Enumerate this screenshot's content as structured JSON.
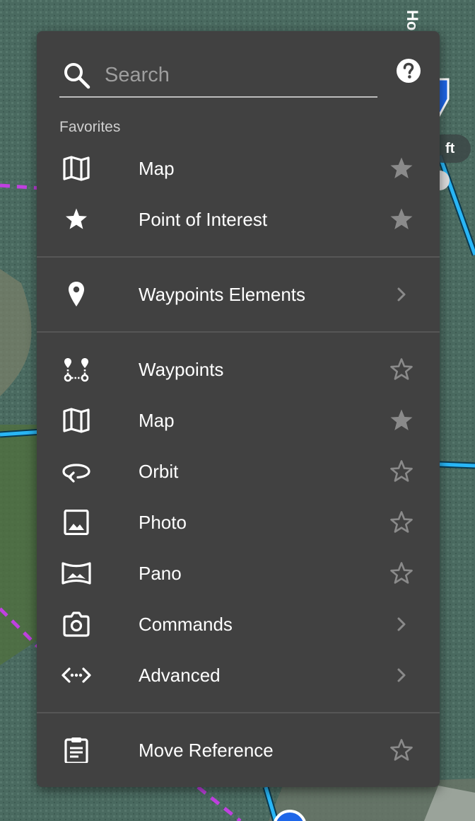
{
  "search": {
    "placeholder": "Search"
  },
  "map_overlay": {
    "scale_unit": "ft",
    "route_label": "Ho"
  },
  "favorites": {
    "heading": "Favorites",
    "items": [
      {
        "label": "Map",
        "icon": "map-icon",
        "starred": true
      },
      {
        "label": "Point of Interest",
        "icon": "star-icon",
        "starred": true
      }
    ]
  },
  "group": {
    "label": "Waypoints Elements",
    "icon": "location-pin-icon",
    "trailing": "chevron-right-icon"
  },
  "items": [
    {
      "label": "Waypoints",
      "icon": "waypoints-icon",
      "trailing": "star-outline"
    },
    {
      "label": "Map",
      "icon": "map-icon",
      "trailing": "star-filled"
    },
    {
      "label": "Orbit",
      "icon": "orbit-icon",
      "trailing": "star-outline"
    },
    {
      "label": "Photo",
      "icon": "photo-icon",
      "trailing": "star-outline"
    },
    {
      "label": "Pano",
      "icon": "panorama-icon",
      "trailing": "star-outline"
    },
    {
      "label": "Commands",
      "icon": "camera-icon",
      "trailing": "chevron-right"
    },
    {
      "label": "Advanced",
      "icon": "code-arrows-icon",
      "trailing": "chevron-right"
    }
  ],
  "footer_item": {
    "label": "Move Reference",
    "icon": "clipboard-icon",
    "trailing": "star-outline"
  },
  "colors": {
    "panel": "#414141",
    "divider": "#565656",
    "route_cyan": "#29b6f6",
    "route_magenta": "#c040e0",
    "star_gray": "#8a8a8a"
  }
}
